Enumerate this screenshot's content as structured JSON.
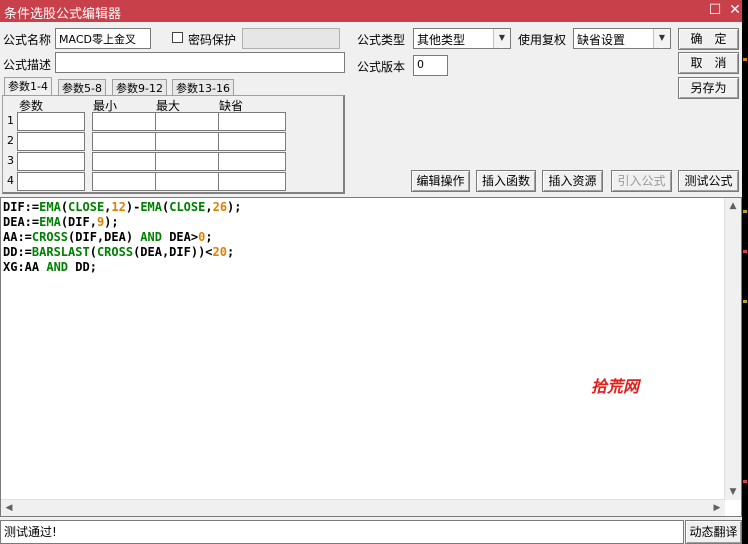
{
  "window": {
    "title": "条件选股公式编辑器",
    "maximize_glyph": "☐",
    "close_glyph": "✕"
  },
  "form": {
    "name_label": "公式名称",
    "name_value": "MACD零上金叉",
    "password_label": "密码保护",
    "desc_label": "公式描述",
    "desc_value": "",
    "type_label": "公式类型",
    "type_value": "其他类型",
    "fq_label": "使用复权",
    "fq_value": "缺省设置",
    "version_label": "公式版本",
    "version_value": "0"
  },
  "buttons": {
    "ok": "确　定",
    "cancel": "取　消",
    "save_as": "另存为",
    "edit_op": "编辑操作",
    "insert_fn": "插入函数",
    "insert_res": "插入资源",
    "import_formula": "引入公式",
    "test_formula": "测试公式",
    "dynamic_translate": "动态翻译"
  },
  "tabs": [
    "参数1-4",
    "参数5-8",
    "参数9-12",
    "参数13-16"
  ],
  "params": {
    "headers": [
      "参数",
      "最小",
      "最大",
      "缺省"
    ],
    "rows": [
      "1",
      "2",
      "3",
      "4"
    ]
  },
  "code_lines": [
    [
      [
        "DIF:=",
        "op"
      ],
      [
        "EMA",
        "fn"
      ],
      [
        "(",
        "op"
      ],
      [
        "CLOSE",
        "fn"
      ],
      [
        ",",
        "op"
      ],
      [
        "12",
        "num"
      ],
      [
        ")-",
        "op"
      ],
      [
        "EMA",
        "fn"
      ],
      [
        "(",
        "op"
      ],
      [
        "CLOSE",
        "fn"
      ],
      [
        ",",
        "op"
      ],
      [
        "26",
        "num"
      ],
      [
        ");",
        "op"
      ]
    ],
    [
      [
        "DEA:=",
        "op"
      ],
      [
        "EMA",
        "fn"
      ],
      [
        "(DIF,",
        "op"
      ],
      [
        "9",
        "num"
      ],
      [
        ");",
        "op"
      ]
    ],
    [
      [
        "AA:=",
        "op"
      ],
      [
        "CROSS",
        "fn"
      ],
      [
        "(DIF,DEA) ",
        "op"
      ],
      [
        "AND",
        "kw"
      ],
      [
        " DEA>",
        "op"
      ],
      [
        "0",
        "num"
      ],
      [
        ";",
        "op"
      ]
    ],
    [
      [
        "DD:=",
        "op"
      ],
      [
        "BARSLAST",
        "fn"
      ],
      [
        "(",
        "op"
      ],
      [
        "CROSS",
        "fn"
      ],
      [
        "(DEA,DIF))<",
        "op"
      ],
      [
        "20",
        "num"
      ],
      [
        ";",
        "op"
      ]
    ],
    [
      [
        "XG:AA ",
        "op"
      ],
      [
        "AND",
        "kw"
      ],
      [
        " DD;",
        "op"
      ]
    ]
  ],
  "watermark": "拾荒网",
  "status_text": "测试通过!",
  "colors": {
    "titlebar": "#c8404a",
    "function": "#008000",
    "number": "#e08000",
    "watermark": "#e0201c"
  }
}
